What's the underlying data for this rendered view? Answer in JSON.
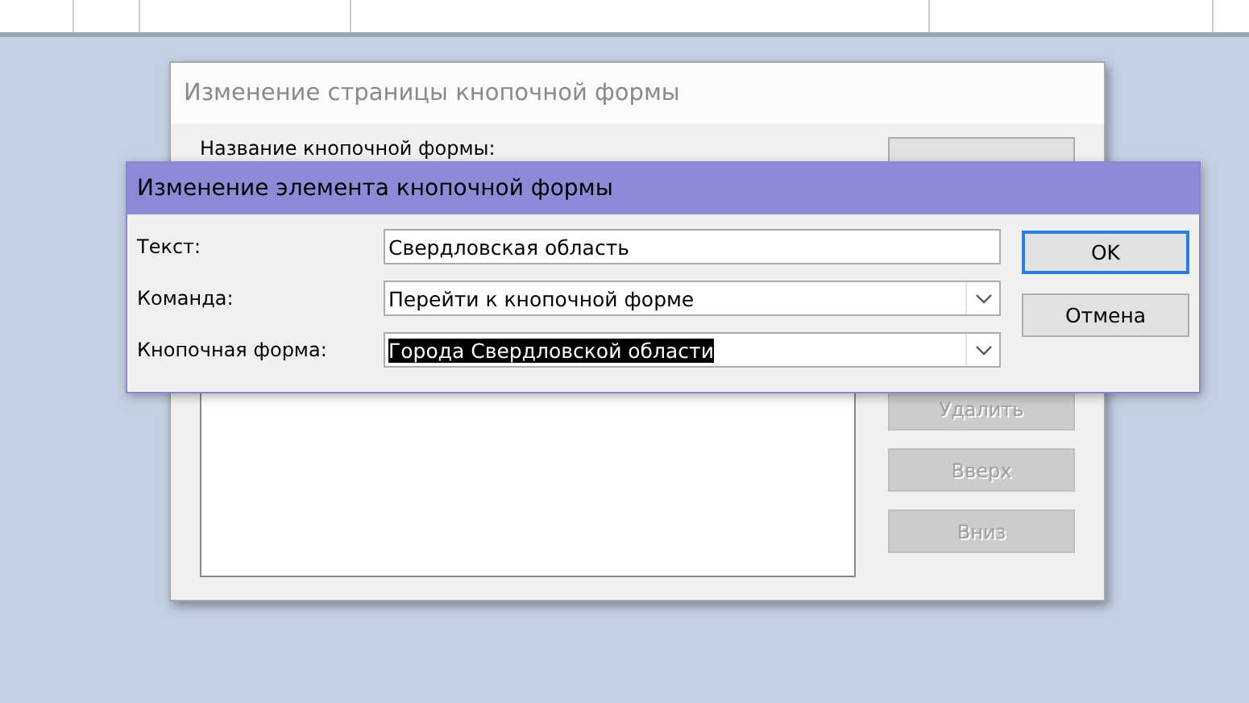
{
  "back_dialog": {
    "title": "Изменение страницы кнопочной формы",
    "active": false,
    "name_label": "Название кнопочной формы:",
    "buttons": [
      {
        "label": "Удалить",
        "disabled": true
      },
      {
        "label": "Вверх",
        "disabled": true
      },
      {
        "label": "Вниз",
        "disabled": true
      }
    ]
  },
  "dialog": {
    "title": "Изменение элемента кнопочной формы",
    "active": true,
    "fields": [
      {
        "kind": "text",
        "label": "Текст:",
        "value": "Свердловская область",
        "selected": false
      },
      {
        "kind": "combo",
        "label": "Команда:",
        "value": "Перейти к кнопочной форме",
        "selected": false
      },
      {
        "kind": "combo",
        "label": "Кнопочная форма:",
        "value": "Города Свердловской области",
        "selected": true
      }
    ],
    "buttons": [
      {
        "label": "OK",
        "default": true
      },
      {
        "label": "Отмена",
        "default": false
      }
    ]
  }
}
